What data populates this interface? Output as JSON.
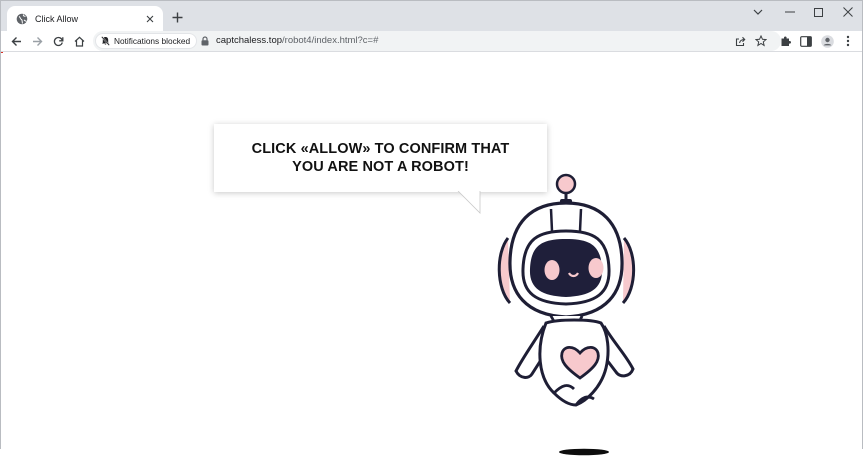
{
  "browser": {
    "tab": {
      "title": "Click Allow"
    },
    "notifications_chip": "Notifications blocked",
    "url_host": "captchaless.top",
    "url_path": "/robot4/index.html?c=#"
  },
  "page": {
    "headline": "CLICK «ALLOW» TO CONFIRM THAT YOU ARE NOT A ROBOT!"
  },
  "colors": {
    "robot_outline": "#1e1e35",
    "robot_pink": "#f7c9cd",
    "robot_face": "#1f1f3a"
  }
}
